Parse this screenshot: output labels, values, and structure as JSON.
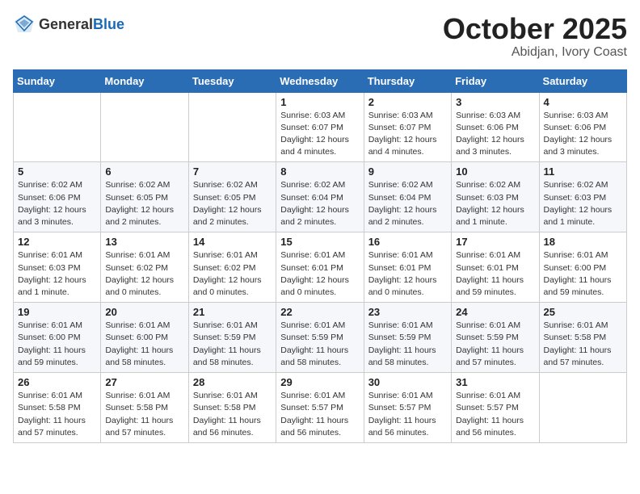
{
  "logo": {
    "general": "General",
    "blue": "Blue"
  },
  "header": {
    "month": "October 2025",
    "location": "Abidjan, Ivory Coast"
  },
  "weekdays": [
    "Sunday",
    "Monday",
    "Tuesday",
    "Wednesday",
    "Thursday",
    "Friday",
    "Saturday"
  ],
  "weeks": [
    [
      {
        "day": "",
        "info": ""
      },
      {
        "day": "",
        "info": ""
      },
      {
        "day": "",
        "info": ""
      },
      {
        "day": "1",
        "info": "Sunrise: 6:03 AM\nSunset: 6:07 PM\nDaylight: 12 hours\nand 4 minutes."
      },
      {
        "day": "2",
        "info": "Sunrise: 6:03 AM\nSunset: 6:07 PM\nDaylight: 12 hours\nand 4 minutes."
      },
      {
        "day": "3",
        "info": "Sunrise: 6:03 AM\nSunset: 6:06 PM\nDaylight: 12 hours\nand 3 minutes."
      },
      {
        "day": "4",
        "info": "Sunrise: 6:03 AM\nSunset: 6:06 PM\nDaylight: 12 hours\nand 3 minutes."
      }
    ],
    [
      {
        "day": "5",
        "info": "Sunrise: 6:02 AM\nSunset: 6:06 PM\nDaylight: 12 hours\nand 3 minutes."
      },
      {
        "day": "6",
        "info": "Sunrise: 6:02 AM\nSunset: 6:05 PM\nDaylight: 12 hours\nand 2 minutes."
      },
      {
        "day": "7",
        "info": "Sunrise: 6:02 AM\nSunset: 6:05 PM\nDaylight: 12 hours\nand 2 minutes."
      },
      {
        "day": "8",
        "info": "Sunrise: 6:02 AM\nSunset: 6:04 PM\nDaylight: 12 hours\nand 2 minutes."
      },
      {
        "day": "9",
        "info": "Sunrise: 6:02 AM\nSunset: 6:04 PM\nDaylight: 12 hours\nand 2 minutes."
      },
      {
        "day": "10",
        "info": "Sunrise: 6:02 AM\nSunset: 6:03 PM\nDaylight: 12 hours\nand 1 minute."
      },
      {
        "day": "11",
        "info": "Sunrise: 6:02 AM\nSunset: 6:03 PM\nDaylight: 12 hours\nand 1 minute."
      }
    ],
    [
      {
        "day": "12",
        "info": "Sunrise: 6:01 AM\nSunset: 6:03 PM\nDaylight: 12 hours\nand 1 minute."
      },
      {
        "day": "13",
        "info": "Sunrise: 6:01 AM\nSunset: 6:02 PM\nDaylight: 12 hours\nand 0 minutes."
      },
      {
        "day": "14",
        "info": "Sunrise: 6:01 AM\nSunset: 6:02 PM\nDaylight: 12 hours\nand 0 minutes."
      },
      {
        "day": "15",
        "info": "Sunrise: 6:01 AM\nSunset: 6:01 PM\nDaylight: 12 hours\nand 0 minutes."
      },
      {
        "day": "16",
        "info": "Sunrise: 6:01 AM\nSunset: 6:01 PM\nDaylight: 12 hours\nand 0 minutes."
      },
      {
        "day": "17",
        "info": "Sunrise: 6:01 AM\nSunset: 6:01 PM\nDaylight: 11 hours\nand 59 minutes."
      },
      {
        "day": "18",
        "info": "Sunrise: 6:01 AM\nSunset: 6:00 PM\nDaylight: 11 hours\nand 59 minutes."
      }
    ],
    [
      {
        "day": "19",
        "info": "Sunrise: 6:01 AM\nSunset: 6:00 PM\nDaylight: 11 hours\nand 59 minutes."
      },
      {
        "day": "20",
        "info": "Sunrise: 6:01 AM\nSunset: 6:00 PM\nDaylight: 11 hours\nand 58 minutes."
      },
      {
        "day": "21",
        "info": "Sunrise: 6:01 AM\nSunset: 5:59 PM\nDaylight: 11 hours\nand 58 minutes."
      },
      {
        "day": "22",
        "info": "Sunrise: 6:01 AM\nSunset: 5:59 PM\nDaylight: 11 hours\nand 58 minutes."
      },
      {
        "day": "23",
        "info": "Sunrise: 6:01 AM\nSunset: 5:59 PM\nDaylight: 11 hours\nand 58 minutes."
      },
      {
        "day": "24",
        "info": "Sunrise: 6:01 AM\nSunset: 5:59 PM\nDaylight: 11 hours\nand 57 minutes."
      },
      {
        "day": "25",
        "info": "Sunrise: 6:01 AM\nSunset: 5:58 PM\nDaylight: 11 hours\nand 57 minutes."
      }
    ],
    [
      {
        "day": "26",
        "info": "Sunrise: 6:01 AM\nSunset: 5:58 PM\nDaylight: 11 hours\nand 57 minutes."
      },
      {
        "day": "27",
        "info": "Sunrise: 6:01 AM\nSunset: 5:58 PM\nDaylight: 11 hours\nand 57 minutes."
      },
      {
        "day": "28",
        "info": "Sunrise: 6:01 AM\nSunset: 5:58 PM\nDaylight: 11 hours\nand 56 minutes."
      },
      {
        "day": "29",
        "info": "Sunrise: 6:01 AM\nSunset: 5:57 PM\nDaylight: 11 hours\nand 56 minutes."
      },
      {
        "day": "30",
        "info": "Sunrise: 6:01 AM\nSunset: 5:57 PM\nDaylight: 11 hours\nand 56 minutes."
      },
      {
        "day": "31",
        "info": "Sunrise: 6:01 AM\nSunset: 5:57 PM\nDaylight: 11 hours\nand 56 minutes."
      },
      {
        "day": "",
        "info": ""
      }
    ]
  ]
}
